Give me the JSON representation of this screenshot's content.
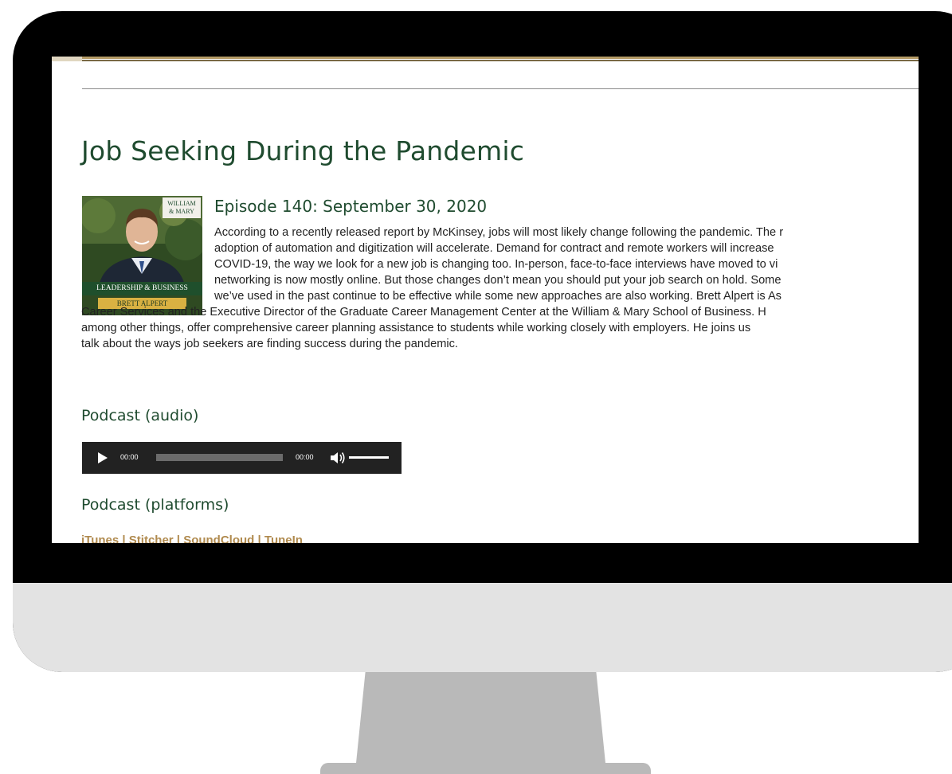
{
  "page": {
    "title": "Job Seeking During the Pandemic",
    "episode": "Episode 140: September 30, 2020",
    "paragraph_lines": [
      "According to a recently released report by McKinsey, jobs will most likely change following the pandemic. The r",
      "adoption of automation and digitization will accelerate. Demand for contract and remote workers will increase",
      "COVID-19, the way we look for a new job is changing too. In-person, face-to-face interviews have moved to vi",
      "networking is now mostly online. But those changes don’t mean you should put your job search on hold. Some",
      "we’ve used in the past continue to be effective while some new approaches are also working. Brett Alpert is As",
      "Career Services and the Executive Director of the Graduate Career Management Center at the William & Mary School of Business. H",
      "among other things, offer comprehensive career planning assistance to students while working closely with employers. He joins us",
      "talk about the ways job seekers are finding success during the pandemic."
    ],
    "audio_heading": "Podcast (audio)",
    "platforms_heading": "Podcast (platforms)"
  },
  "thumbnail": {
    "logo_line1": "WILLIAM",
    "logo_line2": "& MARY",
    "banner": "LEADERSHIP & BUSINESS",
    "host": "BRETT ALPERT"
  },
  "player": {
    "current_time": "00:00",
    "duration": "00:00",
    "progress": 0,
    "volume": 1
  },
  "platforms": {
    "itunes": "iTunes",
    "sep1": " | ",
    "stitcher": "Stitcher",
    "sep2": " | ",
    "soundcloud": "SoundCloud",
    "sep3": " | ",
    "tunein": "TuneIn"
  },
  "colors": {
    "heading_green": "#1f4b2f",
    "link_gold": "#b08a4e",
    "monitor_bezel": "#000000",
    "monitor_chin": "#e3e3e3",
    "stand": "#b9b9b9"
  }
}
